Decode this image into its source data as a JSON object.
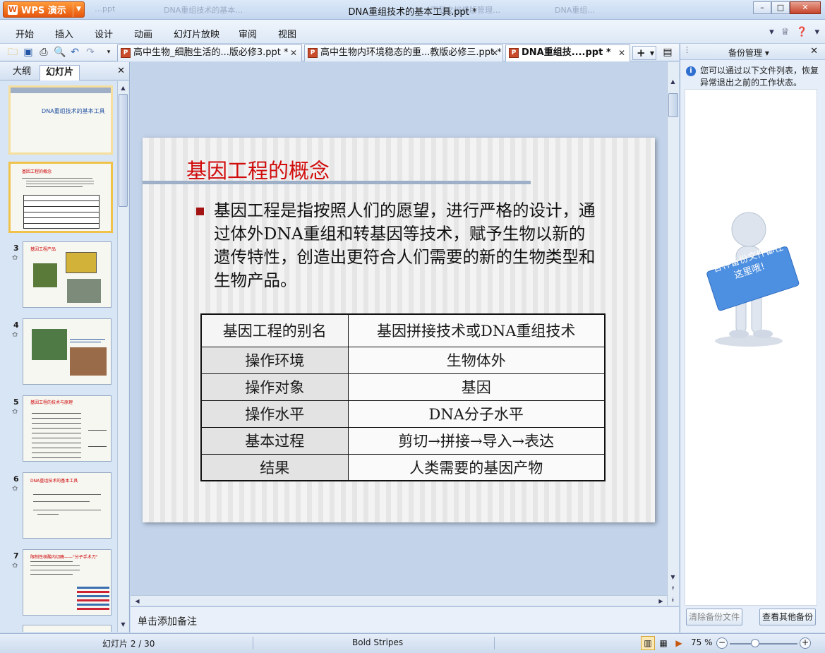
{
  "app": {
    "name": "WPS 演示",
    "window_title": "DNA重组技术的基本工具.ppt *"
  },
  "ghost_tabs": [
    "…ppt",
    "DNA重组技术的基本…",
    "下载文档模版管理…",
    "DNA重组…"
  ],
  "menu": [
    "开始",
    "插入",
    "设计",
    "动画",
    "幻灯片放映",
    "审阅",
    "视图"
  ],
  "doc_tabs": [
    {
      "label": "高中生物_细胞生活的...版必修3.ppt *"
    },
    {
      "label": "高中生物内环境稳态的重...教版必修三.ppt *"
    },
    {
      "label": "DNA重组技....ppt *"
    }
  ],
  "left_panel": {
    "tabs": [
      "大纲",
      "幻灯片"
    ],
    "thumbnails": [
      {
        "num": "1",
        "title": "DNA重组技术的基本工具"
      },
      {
        "num": "2",
        "title": "基因工程的概念"
      },
      {
        "num": "3",
        "title": "基因工程产品"
      },
      {
        "num": "4",
        "title": ""
      },
      {
        "num": "5",
        "title": "基因工程的技术与原理"
      },
      {
        "num": "6",
        "title": "DNA重组技术的基本工具"
      },
      {
        "num": "7",
        "title": "限制性核酸内切酶——\"分子手术刀\""
      }
    ]
  },
  "slide": {
    "title": "基因工程的概念",
    "bullet": "基因工程是指按照人们的愿望，进行严格的设计，通过体外DNA重组和转基因等技术，赋予生物以新的遗传特性，创造出更符合人们需要的新的生物类型和生物产品。",
    "table": [
      [
        "基因工程的别名",
        "基因拼接技术或DNA重组技术"
      ],
      [
        "操作环境",
        "生物体外"
      ],
      [
        "操作对象",
        "基因"
      ],
      [
        "操作水平",
        "DNA分子水平"
      ],
      [
        "基本过程",
        "剪切→拼接→导入→表达"
      ],
      [
        "结果",
        "人类需要的基因产物"
      ]
    ]
  },
  "notes_placeholder": "单击添加备注",
  "backup_panel": {
    "title": "备份管理",
    "info": "您可以通过以下文件列表，恢复异常退出之前的工作状态。",
    "figure_sign": "各种备份文件都在这里哦！",
    "clear_button": "清除备份文件",
    "other_button": "查看其他备份"
  },
  "status": {
    "slide_counter": "幻灯片 2 / 30",
    "theme": "Bold Stripes",
    "zoom": "75 %",
    "zoom_fraction": 0.37
  },
  "colors": {
    "accent": "#e5560c",
    "title_red": "#d10c0c",
    "bullet_red": "#a31313"
  }
}
